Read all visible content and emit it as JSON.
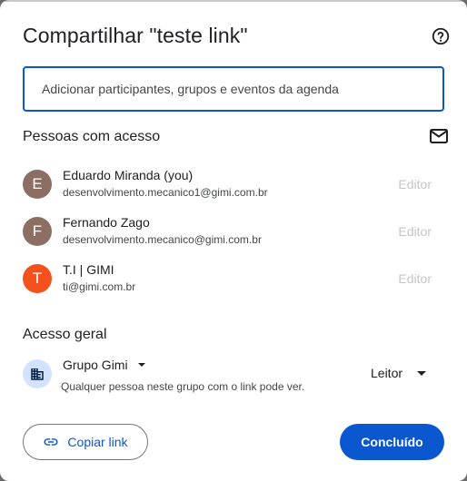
{
  "dialog": {
    "title": "Compartilhar \"teste link\"",
    "help_icon": "help-circle-icon"
  },
  "add_people": {
    "placeholder": "Adicionar participantes, grupos e eventos da agenda"
  },
  "people_section": {
    "title": "Pessoas com acesso",
    "mail_icon": "mail-icon",
    "people": [
      {
        "initial": "E",
        "name": "Eduardo Miranda (you)",
        "email": "desenvolvimento.mecanico1@gimi.com.br",
        "role": "Editor",
        "avatar_color": "#8d6e63"
      },
      {
        "initial": "F",
        "name": "Fernando Zago",
        "email": "desenvolvimento.mecanico@gimi.com.br",
        "role": "Editor",
        "avatar_color": "#8d6e63"
      },
      {
        "initial": "T",
        "name": "T.I | GIMI",
        "email": "ti@gimi.com.br",
        "role": "Editor",
        "avatar_color": "#f4511e"
      }
    ]
  },
  "general_access": {
    "title": "Acesso geral",
    "group_icon": "domain-icon",
    "group_name": "Grupo Gimi",
    "description": "Qualquer pessoa neste grupo com o link pode ver.",
    "role": "Leitor"
  },
  "footer": {
    "copy_link_label": "Copiar link",
    "copy_link_icon": "link-icon",
    "done_label": "Concluído"
  },
  "colors": {
    "accent": "#0b57d0",
    "group_icon_bg": "#d3e3fd",
    "disabled_text": "#c4c7c5"
  }
}
